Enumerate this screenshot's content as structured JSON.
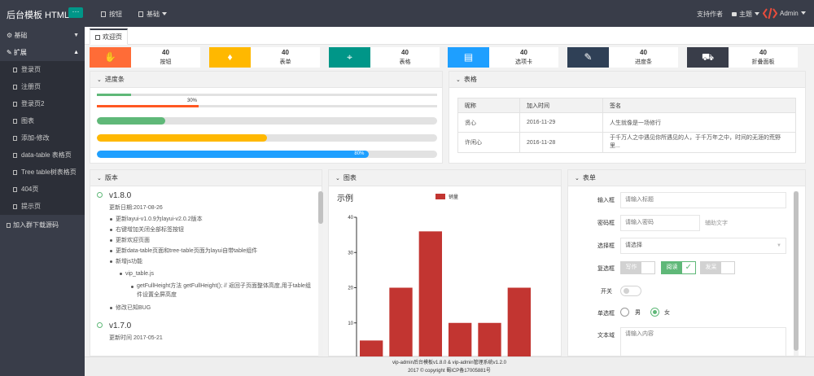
{
  "header": {
    "logo": "后台模板 HTML",
    "nav": [
      {
        "label": "按钮",
        "icon": "doc-icon"
      },
      {
        "label": "基础",
        "icon": "doc-icon",
        "dropdown": true
      }
    ],
    "support": "支持作者",
    "theme": "主题",
    "user": "Admin"
  },
  "sidebar": {
    "groups": [
      {
        "label": "基础",
        "expanded": false
      },
      {
        "label": "扩展",
        "expanded": true,
        "items": [
          "登录页",
          "注册页",
          "登录页2",
          "图表",
          "添加-修改",
          "data-table 表格页",
          "Tree table树表格页",
          "404页",
          "提示页"
        ]
      },
      {
        "label": "加入群下载源码"
      }
    ]
  },
  "tabs": [
    {
      "label": "欢迎页",
      "active": true
    }
  ],
  "stats": [
    {
      "value": "40",
      "label": "按钮",
      "color": "#ff6c37",
      "icon": "hand-icon"
    },
    {
      "value": "40",
      "label": "表单",
      "color": "#ffb800",
      "icon": "diamond-icon"
    },
    {
      "value": "40",
      "label": "表格",
      "color": "#009688",
      "icon": "location-icon"
    },
    {
      "value": "40",
      "label": "选项卡",
      "color": "#1e9fff",
      "icon": "book-icon"
    },
    {
      "value": "40",
      "label": "进度条",
      "color": "#2f4056",
      "icon": "edit-icon"
    },
    {
      "value": "40",
      "label": "折叠面板",
      "color": "#393d49",
      "icon": "cart-icon"
    }
  ],
  "progress_panel": {
    "title": "进度条",
    "bars": [
      {
        "value": 0.1,
        "color": "#5fb878",
        "label": ""
      },
      {
        "value": 0.3,
        "color": "#ff5722",
        "label": "30%"
      },
      {
        "value": 0.2,
        "color": "#5fb878",
        "label": ""
      },
      {
        "value": 0.5,
        "color": "#ffb800",
        "label": ""
      },
      {
        "value": 0.8,
        "color": "#1e9fff",
        "label": "80%"
      }
    ]
  },
  "table_panel": {
    "title": "表格",
    "columns": [
      "昵称",
      "加入时间",
      "签名"
    ],
    "rows": [
      [
        "贤心",
        "2016-11-29",
        "人生就像是一场修行"
      ],
      [
        "许闲心",
        "2016-11-28",
        "于千万人之中遇见你所遇见的人，于千万年之中，时间的无涯的荒野里..."
      ]
    ]
  },
  "version_panel": {
    "title": "版本",
    "entries": [
      {
        "version": "v1.8.0",
        "date": "更新日期:2017-08-26",
        "items": [
          "更新layui-v1.0.9为layui-v2.0.2版本",
          "右键增加关闭全部标签按钮",
          "更新欢迎页面",
          "更新data-table页面和tree-table页面为layui自带table组件",
          "新增js功能"
        ],
        "sub": "vip_table.js",
        "subsub": "getFullHeight方法 getFullHeight(); // 返回子页面整体高度,用于table组件设置全屏高度",
        "after": "修改已知BUG"
      },
      {
        "version": "v1.7.0",
        "date": "更新时间 2017-05-21"
      }
    ]
  },
  "chart_panel": {
    "title": "图表"
  },
  "chart_data": {
    "type": "bar",
    "title": "示例",
    "categories": [
      "",
      "",
      "",
      "",
      "",
      ""
    ],
    "series": [
      {
        "name": "销量",
        "values": [
          5,
          20,
          36,
          10,
          10,
          20
        ],
        "color": "#c23531"
      }
    ],
    "ylim": [
      0,
      40
    ],
    "yticks": [
      "0",
      "10",
      "20",
      "30",
      "40"
    ]
  },
  "form_panel": {
    "title": "表单",
    "input_label": "输入框",
    "input_placeholder": "请输入标题",
    "password_label": "密码框",
    "password_placeholder": "请输入密码",
    "aux_text": "辅助文字",
    "select_label": "选择框",
    "select_value": "请选择",
    "checkbox_label": "复选框",
    "checkboxes": [
      {
        "label": "写作",
        "checked": false
      },
      {
        "label": "阅读",
        "checked": true
      },
      {
        "label": "发呆",
        "checked": false
      }
    ],
    "switch_label": "开关",
    "switch_on": false,
    "radio_label": "单选框",
    "radios": [
      {
        "label": "男",
        "checked": false
      },
      {
        "label": "女",
        "checked": true
      }
    ],
    "textarea_label": "文本域",
    "textarea_placeholder": "请输入内容"
  },
  "footer": {
    "line1": "vip-admin后台模板v1.8.0  &  vip-admin管理系统v1.2.0",
    "line2": "2017 © copyright 蜀ICP备17005881号"
  }
}
